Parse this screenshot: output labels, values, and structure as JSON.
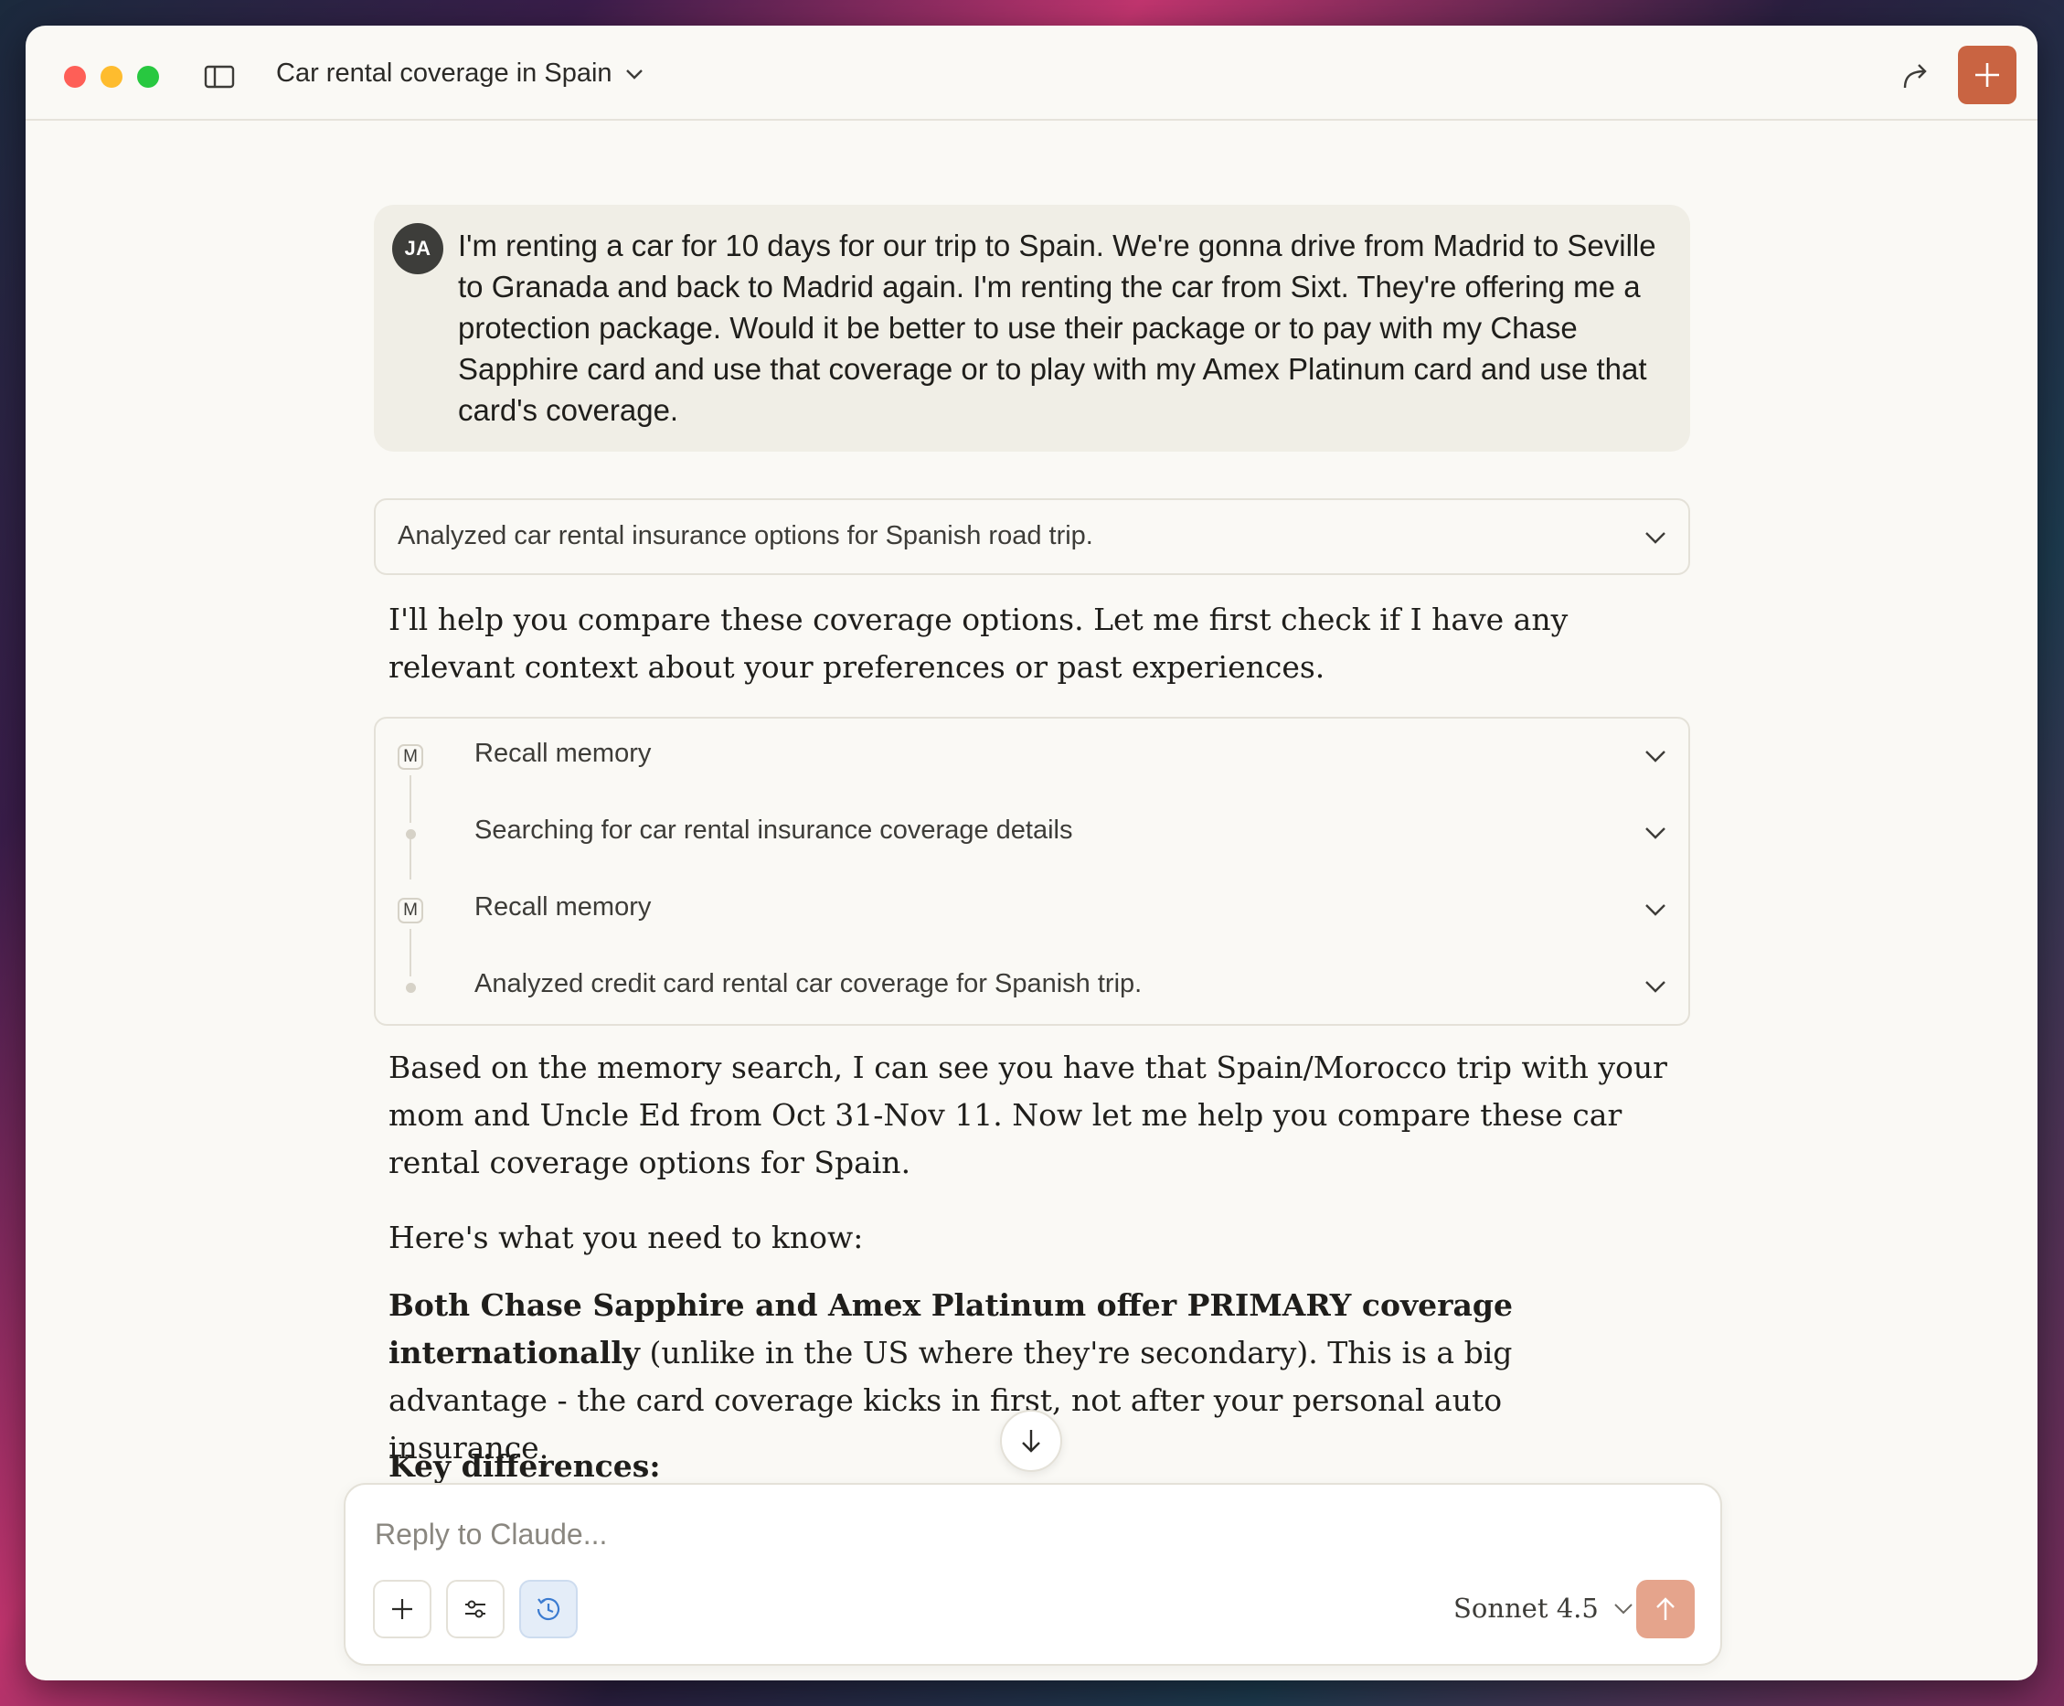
{
  "window": {
    "chat_title": "Car rental coverage in Spain"
  },
  "user_message": {
    "avatar_initials": "JA",
    "text": "I'm renting a car for 10 days for our trip to Spain. We're gonna drive from Madrid to Seville to Granada and back to Madrid again. I'm renting the car from Sixt. They're offering me a protection package. Would it be better to use their package or to pay with my Chase Sapphire card and use that coverage or to play with my Amex Platinum card and use that card's coverage."
  },
  "thinking_summary": "Analyzed car rental insurance options for Spanish road trip.",
  "assistant": {
    "intro": "I'll help you compare these coverage options. Let me first check if I have any relevant context about your preferences or past experiences.",
    "tool_steps": [
      {
        "badge": "M",
        "label": "Recall memory"
      },
      {
        "badge": "",
        "label": "Searching for car rental insurance coverage details"
      },
      {
        "badge": "M",
        "label": "Recall memory"
      },
      {
        "badge": "",
        "label": "Analyzed credit card rental car coverage for Spanish trip."
      }
    ],
    "memory_paragraph": "Based on the memory search, I can see you have that Spain/Morocco trip with your mom and Uncle Ed from Oct 31-Nov 11. Now let me help you compare these car rental coverage options for Spain.",
    "need_to_know": "Here's what you need to know:",
    "primary_bold": "Both Chase Sapphire and Amex Platinum offer PRIMARY coverage internationally",
    "primary_rest": " (unlike in the US where they're secondary). This is a big advantage - the card coverage kicks in first, not after your personal auto insurance.",
    "key_differences": "Key differences:"
  },
  "composer": {
    "placeholder": "Reply to Claude...",
    "model": "Sonnet 4.5"
  },
  "icons": {
    "sidebar": "sidebar-toggle-icon",
    "share": "share-icon",
    "new_chat": "plus-icon",
    "scroll": "arrow-down-icon",
    "attach": "plus-icon",
    "settings": "sliders-icon",
    "history": "clock-icon",
    "send": "arrow-up-icon"
  },
  "colors": {
    "accent": "#c96442",
    "send_disabled": "#e5a48c",
    "background": "#faf9f5",
    "user_bubble": "#f0eee6"
  }
}
